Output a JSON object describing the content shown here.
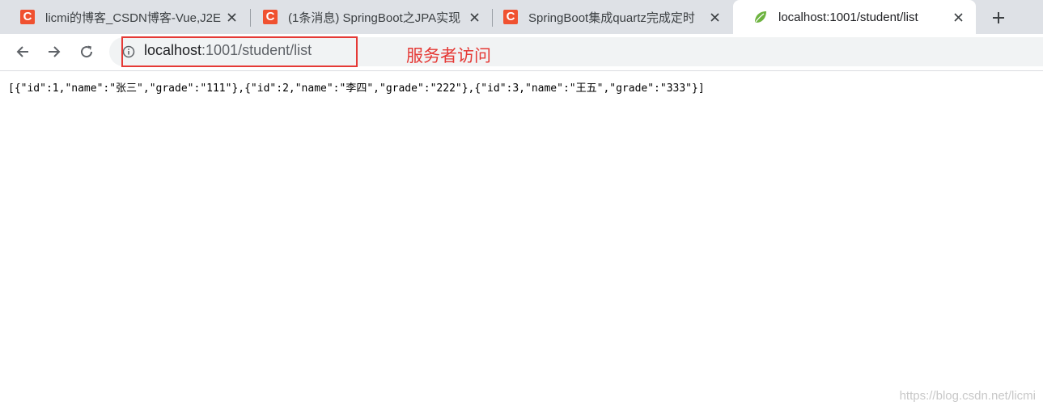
{
  "tabs": [
    {
      "title": "licmi的博客_CSDN博客-Vue,J2E",
      "favicon": "csdn-icon",
      "favicon_letter": "C",
      "active": false
    },
    {
      "title": "(1条消息) SpringBoot之JPA实现",
      "favicon": "csdn-icon",
      "favicon_letter": "C",
      "active": false
    },
    {
      "title": "SpringBoot集成quartz完成定时",
      "favicon": "csdn-icon",
      "favicon_letter": "C",
      "active": false
    },
    {
      "title": "localhost:1001/student/list",
      "favicon": "spring-leaf-icon",
      "active": true
    }
  ],
  "toolbar": {
    "url_host": "localhost",
    "url_path": ":1001/student/list",
    "annotation": "服务者访问"
  },
  "page": {
    "json_text": "[{\"id\":1,\"name\":\"张三\",\"grade\":\"111\"},{\"id\":2,\"name\":\"李四\",\"grade\":\"222\"},{\"id\":3,\"name\":\"王五\",\"grade\":\"333\"}]",
    "watermark": "https://blog.csdn.net/licmi"
  },
  "colors": {
    "tabstrip": "#dee1e6",
    "csdn_brand": "#f05130",
    "annotation_red": "#e53935",
    "spring_green": "#6db33f"
  }
}
